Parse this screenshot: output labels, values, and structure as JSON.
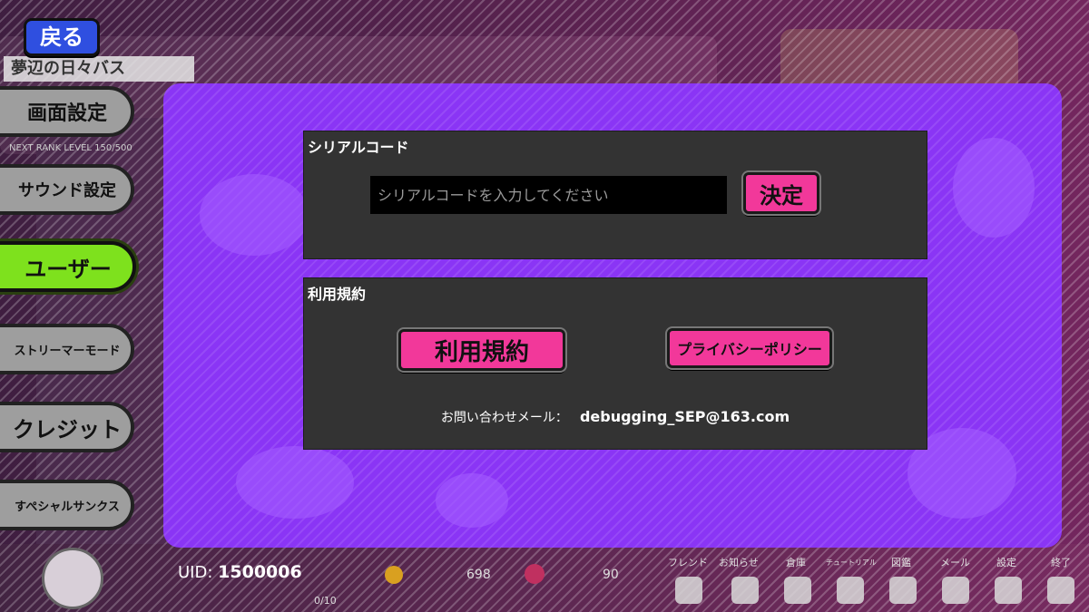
{
  "back_button": {
    "label": "戻る"
  },
  "background": {
    "event_title": "夢辺の日々バス",
    "level_text": "NEXT RANK LEVEL   150/500"
  },
  "sidebar": {
    "items": [
      {
        "label": "画面設定"
      },
      {
        "label": "サウンド設定"
      },
      {
        "label": "ユーザー"
      },
      {
        "label": "ストリーマーモード"
      },
      {
        "label": "クレジット"
      },
      {
        "label": "すぺシャルサンクス"
      }
    ],
    "active_index": 2
  },
  "serial": {
    "title": "シリアルコード",
    "input_value": "",
    "input_placeholder": "シリアルコードを入力してください",
    "submit_label": "決定"
  },
  "terms": {
    "title": "利用規約",
    "terms_button": "利用規約",
    "privacy_button": "プライバシーポリシー",
    "contact_label": "お問い合わせメール：",
    "contact_email": "debugging_SEP@163.com"
  },
  "footer": {
    "uid_label": "UID:",
    "uid_value": "1500006",
    "stamina": "0/10",
    "coins": "698",
    "gems": "90",
    "nav": [
      "フレンド",
      "お知らせ",
      "倉庫",
      "チュートリアル",
      "図鑑",
      "メール",
      "設定",
      "終了"
    ]
  },
  "colors": {
    "panel": "#8a35f5",
    "accent_pink": "#f2389a",
    "active_green": "#7ee11d",
    "back_blue": "#2f4fe0"
  }
}
